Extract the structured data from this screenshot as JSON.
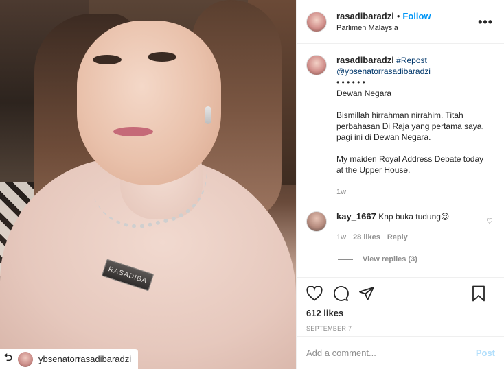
{
  "photo": {
    "badge_text": "RASADIBA",
    "repost_tag": {
      "icon": "repost-icon",
      "username": "ybsenatorrasadibaradzi"
    }
  },
  "header": {
    "username": "rasadibaradzi",
    "separator": "•",
    "follow_label": "Follow",
    "location": "Parlimen Malaysia",
    "more_icon": "more-options-icon"
  },
  "caption": {
    "username": "rasadibaradzi",
    "hashtag": "#Repost",
    "mention": "@ybsenatorrasadibaradzi",
    "dots": "• • • • • •",
    "line_title": "Dewan Negara",
    "para1": "Bismillah hirrahman nirrahim. Titah perbahasan Di Raja yang pertama saya, pagi ini di Dewan Negara.",
    "para2": "My maiden Royal Address Debate today at the Upper House.",
    "time": "1w"
  },
  "comment": {
    "username": "kay_1667",
    "text": "Knp buka tudung😌",
    "time": "1w",
    "likes": "28 likes",
    "reply_label": "Reply",
    "view_replies": "View replies (3)"
  },
  "actions": {
    "icons": [
      "heart-icon",
      "comment-icon",
      "share-icon",
      "bookmark-icon"
    ],
    "likes": "612 likes",
    "date": "SEPTEMBER 7"
  },
  "add_comment": {
    "placeholder": "Add a comment...",
    "post_label": "Post"
  },
  "colors": {
    "link": "#00376b",
    "follow": "#0095f6",
    "muted": "#8e8e8e",
    "post_disabled": "#b2dffc"
  }
}
